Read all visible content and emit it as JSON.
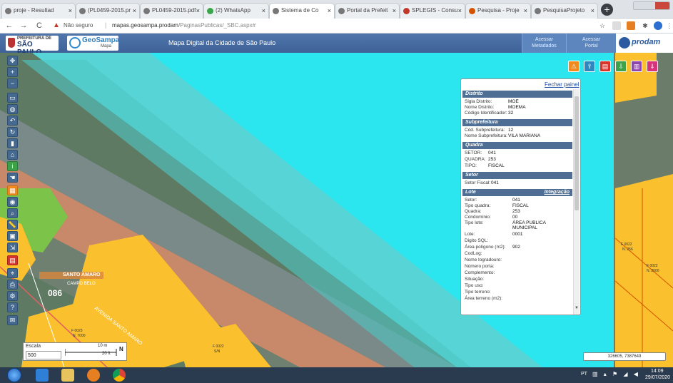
{
  "browser": {
    "tabs": [
      {
        "title": "proje - Resultad",
        "active": false
      },
      {
        "title": "(PL0459-2015.pr",
        "active": false
      },
      {
        "title": "PL0459-2015.pdf",
        "active": false
      },
      {
        "title": "(2) WhatsApp",
        "active": false
      },
      {
        "title": "Sistema de Co",
        "active": true
      },
      {
        "title": "Portal da Prefeit",
        "active": false
      },
      {
        "title": "SPLEGIS - Consu",
        "active": false
      },
      {
        "title": "Pesquisa - Proje",
        "active": false
      },
      {
        "title": "PesquisaProjeto",
        "active": false
      }
    ],
    "new_tab_glyph": "+",
    "back_glyph": "←",
    "forward_glyph": "→",
    "reload_glyph": "C",
    "security_label": "Não seguro",
    "url_host": "mapas.geosampa.prodam",
    "url_path": "/PaginasPublicas/_SBC.aspx#"
  },
  "header": {
    "sp_logo_line1": "PREFEITURA DE",
    "sp_logo_line2": "SÃO PAULO",
    "geosampa_name": "GeoSampa",
    "geosampa_sub": "Mapa",
    "title": "Mapa Digital da Cidade de São Paulo",
    "link_metadados_1": "Acessar",
    "link_metadados_2": "Metadados",
    "link_portal_1": "Acessar",
    "link_portal_2": "Portal",
    "prodam": "prodam"
  },
  "info_panel": {
    "close_label": "Fechar painel",
    "distrito": {
      "title": "Distrito",
      "rows": [
        {
          "label": "Sigla Distrito:",
          "value": "MOE"
        },
        {
          "label": "Nome Distrito:",
          "value": "MOEMA"
        },
        {
          "label": "Código Identificador:",
          "value": "32"
        }
      ]
    },
    "subprefeitura": {
      "title": "Subprefeitura",
      "rows": [
        {
          "label": "Cód. Subprefeitura:",
          "value": "12"
        },
        {
          "label": "Nome Subprefeitura:",
          "value": "VILA MARIANA"
        }
      ]
    },
    "quadra": {
      "title": "Quadra",
      "rows": [
        {
          "label": "SETOR:",
          "value": "041"
        },
        {
          "label": "QUADRA:",
          "value": "253"
        },
        {
          "label": "TIPO:",
          "value": "FISCAL"
        }
      ]
    },
    "setor": {
      "title": "Setor",
      "rows": [
        {
          "label": "Setor Fiscal:",
          "value": "041"
        }
      ]
    },
    "lote": {
      "title": "Lote",
      "integration_label": "Integração",
      "rows": [
        {
          "label": "Setor:",
          "value": "041"
        },
        {
          "label": "Tipo quadra:",
          "value": "FISCAL"
        },
        {
          "label": "Quadra:",
          "value": "253"
        },
        {
          "label": "Condomínio:",
          "value": "00"
        },
        {
          "label": "Tipo lote:",
          "value": "ÁREA PUBLICA"
        },
        {
          "label": "",
          "value": "MUNICIPAL"
        },
        {
          "label": "Lote:",
          "value": "0001"
        },
        {
          "label": "Digito SQL:",
          "value": ""
        },
        {
          "label": "Área polígono (m2):",
          "value": "902"
        },
        {
          "label": "CodLog:",
          "value": ""
        },
        {
          "label": "Nome logradouro:",
          "value": ""
        },
        {
          "label": "Número porta:",
          "value": ""
        },
        {
          "label": "Complemento:",
          "value": ""
        },
        {
          "label": "Situação:",
          "value": ""
        },
        {
          "label": "Tipo uso:",
          "value": ""
        },
        {
          "label": "Tipo terreno:",
          "value": ""
        },
        {
          "label": "Área terreno (m2):",
          "value": ""
        }
      ]
    }
  },
  "map_labels": {
    "santo_amaro": "SANTO AMARO",
    "campo_belo": "CAMPO BELO",
    "district_number": "086",
    "street": "AVENIDA SANTO AMARO",
    "f0022": "F 0022",
    "sn": "S/N",
    "n256": "N. 256",
    "n2000": "N. 2000",
    "f0023": "F 0023",
    "n7000": "N. 7000"
  },
  "scale": {
    "label": "Escala",
    "value": "500",
    "bar_m": "10 m",
    "bar_ft": "20 ft",
    "north": "N"
  },
  "coords": "326605, 7387649",
  "taskbar": {
    "lang": "PT",
    "tray": "▥ ▴ ⚑ ◢ ◀",
    "time": "14:09",
    "date": "29/07/2020"
  },
  "colors": {
    "map_cyan": "#2ce6ef",
    "lot_yellow": "#fbc02d",
    "header_blue": "#4a6fa5",
    "panel_section": "#4e6f93"
  }
}
